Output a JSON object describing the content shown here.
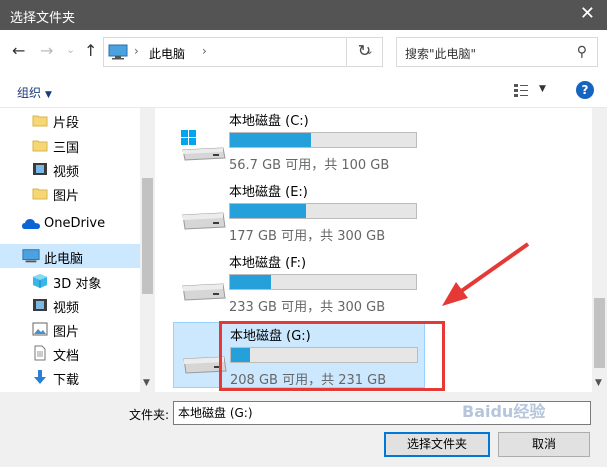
{
  "window": {
    "title": "选择文件夹",
    "close_glyph": "✕"
  },
  "nav": {
    "back": "←",
    "forward": "→",
    "recent_caret": "⌄",
    "up": "↑",
    "address_location": "此电脑",
    "address_sep": "›",
    "address_caret": "⌄",
    "refresh": "↻",
    "search_placeholder": "搜索\"此电脑\"",
    "search_glyph": "⚲"
  },
  "toolbar": {
    "organize": "组织",
    "organize_caret": "▼",
    "view_caret": "▼",
    "help": "?"
  },
  "sidebar": {
    "items": [
      {
        "label": "片段",
        "icon": "folder-icon"
      },
      {
        "label": "三国",
        "icon": "folder-icon"
      },
      {
        "label": "视频",
        "icon": "video-icon"
      },
      {
        "label": "图片",
        "icon": "folder-icon"
      },
      {
        "label": "OneDrive",
        "icon": "cloud-icon"
      },
      {
        "label": "此电脑",
        "icon": "pc-icon",
        "selected": true
      },
      {
        "label": "3D 对象",
        "icon": "cube-icon"
      },
      {
        "label": "视频",
        "icon": "video-icon"
      },
      {
        "label": "图片",
        "icon": "pictures-icon"
      },
      {
        "label": "文档",
        "icon": "document-icon"
      },
      {
        "label": "下载",
        "icon": "download-icon"
      }
    ],
    "scroll_down": "▼"
  },
  "drives": [
    {
      "name": "本地磁盘 (C:)",
      "info": "56.7 GB 可用，共 100 GB",
      "used_fraction": 0.433,
      "system": true
    },
    {
      "name": "本地磁盘 (E:)",
      "info": "177 GB 可用，共 300 GB",
      "used_fraction": 0.41
    },
    {
      "name": "本地磁盘 (F:)",
      "info": "233 GB 可用，共 300 GB",
      "used_fraction": 0.223
    },
    {
      "name": "本地磁盘 (G:)",
      "info": "208 GB 可用，共 231 GB",
      "used_fraction": 0.1,
      "selected": true
    }
  ],
  "content_scroll_down": "▼",
  "footer": {
    "folder_label": "文件夹:",
    "folder_value": "本地磁盘 (G:)",
    "select_button": "选择文件夹",
    "cancel_button": "取消"
  },
  "watermark": "Baidu经验",
  "colors": {
    "accent": "#26a0da",
    "selection": "#cce8ff",
    "annotation": "#e53935",
    "titlebar": "#545454"
  }
}
